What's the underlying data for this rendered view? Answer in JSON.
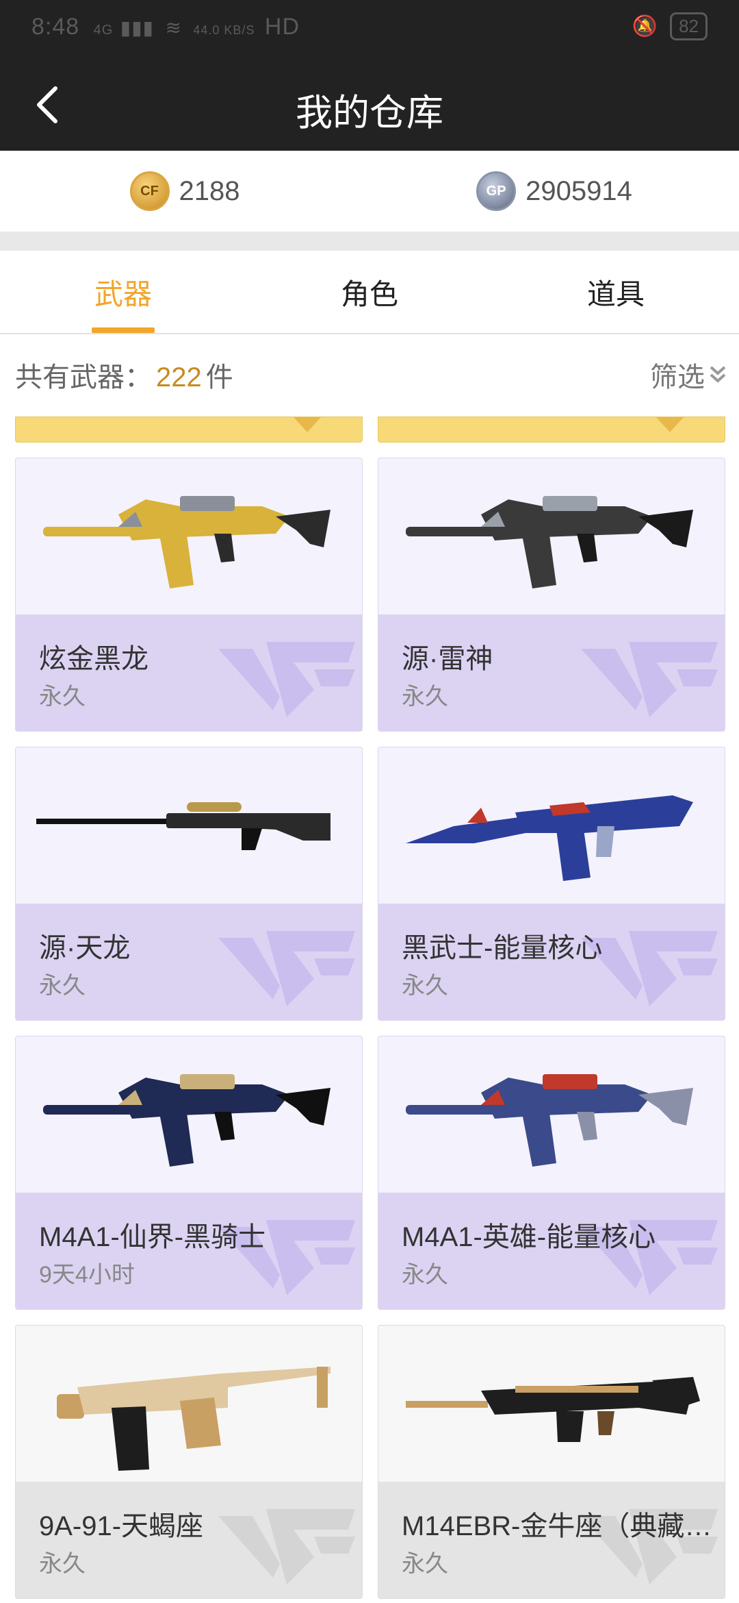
{
  "status_bar": {
    "time": "8:48",
    "network": "4G",
    "speed": "44.0 KB/S",
    "hd": "HD",
    "battery": "82"
  },
  "header": {
    "title": "我的仓库"
  },
  "currency": {
    "cf_amount": "2188",
    "gp_amount": "2905914",
    "cf_icon": "CF",
    "gp_icon": "GP"
  },
  "tabs": [
    {
      "label": "武器",
      "active": true
    },
    {
      "label": "角色",
      "active": false
    },
    {
      "label": "道具",
      "active": false
    }
  ],
  "inventory": {
    "count_label": "共有武器：",
    "count": "222",
    "count_unit": "件",
    "filter_label": "筛选"
  },
  "items": [
    {
      "name": "炫金黑龙",
      "duration": "永久",
      "gun": "rifle",
      "palette": [
        "#d8b23a",
        "#8a8f99",
        "#2b2b2b"
      ]
    },
    {
      "name": "源·雷神",
      "duration": "永久",
      "gun": "rifle",
      "palette": [
        "#3a3a3a",
        "#9aa0aa",
        "#1a1a1a"
      ]
    },
    {
      "name": "源·天龙",
      "duration": "永久",
      "gun": "sniper",
      "palette": [
        "#2a2a2a",
        "#b99a4a",
        "#111111"
      ]
    },
    {
      "name": "黑武士-能量核心",
      "duration": "永久",
      "gun": "ak",
      "palette": [
        "#2b3f9a",
        "#c0392b",
        "#9aa6c8"
      ]
    },
    {
      "name": "M4A1-仙界-黑骑士",
      "duration": "9天4小时",
      "gun": "rifle",
      "palette": [
        "#1f2a55",
        "#c9b07a",
        "#101010"
      ]
    },
    {
      "name": "M4A1-英雄-能量核心",
      "duration": "永久",
      "gun": "rifle",
      "palette": [
        "#3a4a8a",
        "#c0392b",
        "#8a90a8"
      ]
    },
    {
      "name": "9A-91-天蝎座",
      "duration": "永久",
      "gun": "smg",
      "palette": [
        "#1d1d1d",
        "#c9a064",
        "#e0c8a0"
      ]
    },
    {
      "name": "M14EBR-金牛座（典藏…",
      "duration": "永久",
      "gun": "dmr",
      "palette": [
        "#1e1e1e",
        "#c9a064",
        "#6a4a2a"
      ]
    }
  ],
  "colors": {
    "accent": "#f2a52a",
    "header_bg": "#222222",
    "card_info_bg": "#dcd3f3",
    "card_bg": "#f4f2fc"
  }
}
